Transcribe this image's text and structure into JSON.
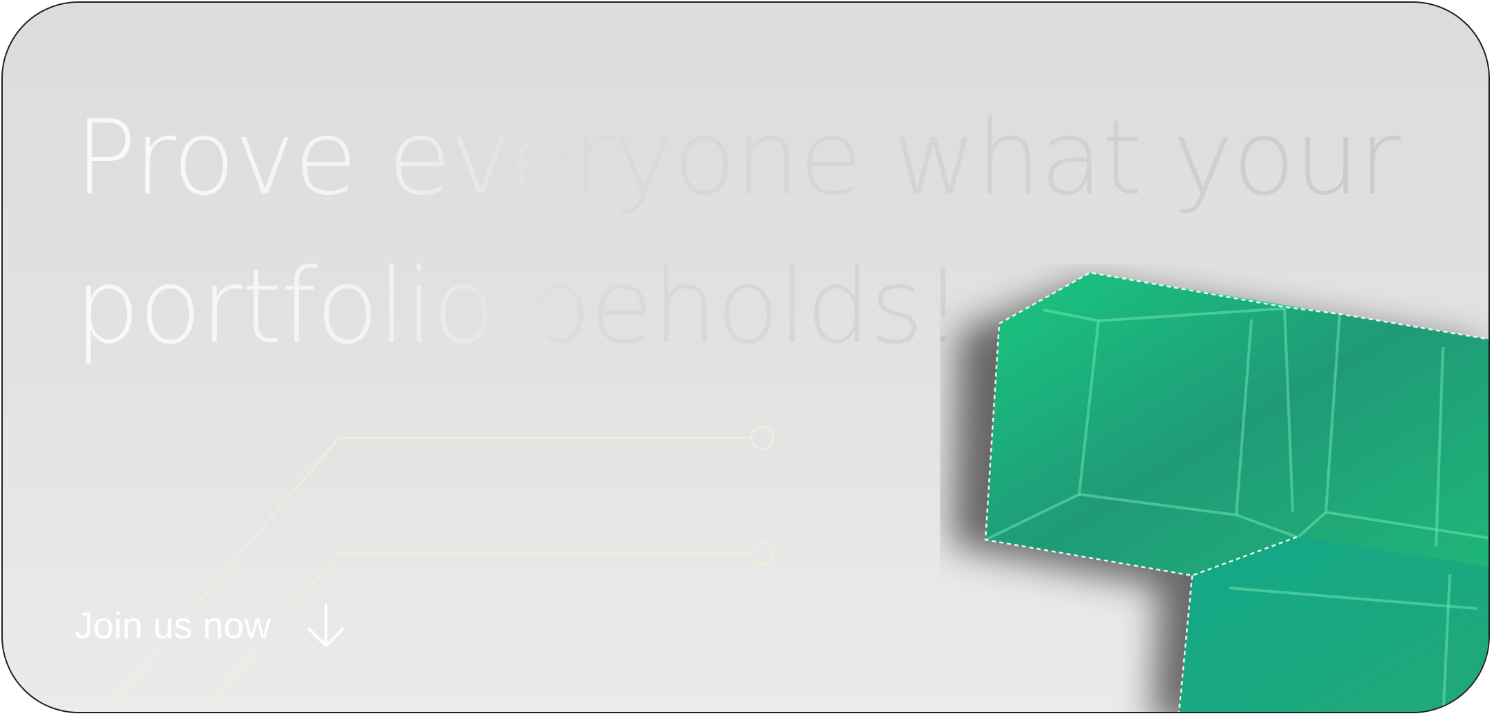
{
  "hero": {
    "headline": "Prove everyone what your portfolio beholds!",
    "cta_label": "Join us now",
    "cta_icon": "arrow-down-icon"
  },
  "colors": {
    "accent": "#1fa56e",
    "text": "#ffffff",
    "background": "#e0e0e0"
  }
}
